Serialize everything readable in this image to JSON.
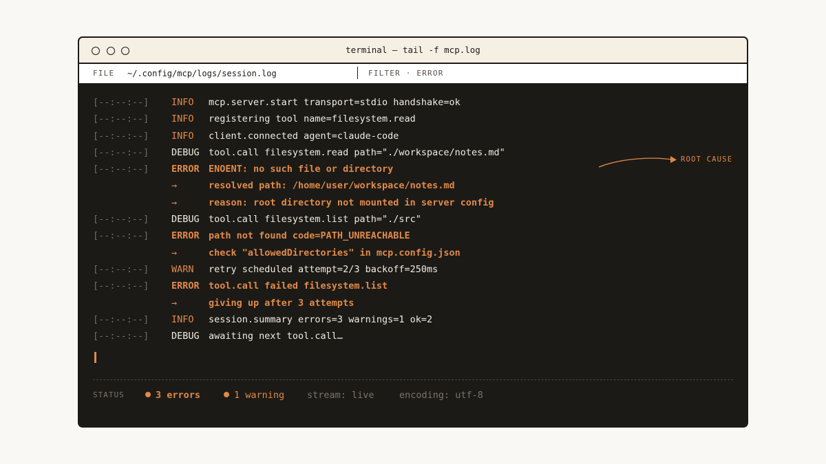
{
  "window": {
    "title": "terminal — tail -f mcp.log",
    "dots": [
      "window-close",
      "window-minimize",
      "window-maximize"
    ]
  },
  "pathbar": {
    "file_label": "FILE",
    "file_path": "~/.config/mcp/logs/session.log",
    "filter_label": "FILTER · ERROR"
  },
  "log": {
    "lines": [
      {
        "ts": "[--:--:--]",
        "level": "INFO",
        "msg": "mcp.server.start transport=stdio handshake=ok"
      },
      {
        "ts": "[--:--:--]",
        "level": "INFO",
        "msg": "registering tool name=filesystem.read"
      },
      {
        "ts": "[--:--:--]",
        "level": "INFO",
        "msg": "client.connected agent=claude-code"
      },
      {
        "ts": "[--:--:--]",
        "level": "DEBUG",
        "msg": "tool.call filesystem.read path=\"./workspace/notes.md\""
      },
      {
        "ts": "[--:--:--]",
        "level": "ERROR",
        "msg": "ENOENT: no such file or directory"
      },
      {
        "ts": "",
        "level": "→",
        "msg": "resolved path: /home/user/workspace/notes.md"
      },
      {
        "ts": "",
        "level": "→",
        "msg": "reason: root directory not mounted in server config"
      },
      {
        "ts": "[--:--:--]",
        "level": "DEBUG",
        "msg": "tool.call filesystem.list path=\"./src\""
      },
      {
        "ts": "[--:--:--]",
        "level": "ERROR",
        "msg": "path not found code=PATH_UNREACHABLE"
      },
      {
        "ts": "",
        "level": "→",
        "msg": "check \"allowedDirectories\" in mcp.config.json"
      },
      {
        "ts": "[--:--:--]",
        "level": "WARN",
        "msg": "retry scheduled attempt=2/3 backoff=250ms"
      },
      {
        "ts": "[--:--:--]",
        "level": "ERROR",
        "msg": "tool.call failed filesystem.list"
      },
      {
        "ts": "",
        "level": "→",
        "msg": "giving up after 3 attempts"
      },
      {
        "ts": "[--:--:--]",
        "level": "INFO",
        "msg": "session.summary errors=3 warnings=1 ok=2"
      },
      {
        "ts": "[--:--:--]",
        "level": "DEBUG",
        "msg": "awaiting next tool.call…"
      }
    ]
  },
  "annotation": {
    "text": "ROOT CAUSE"
  },
  "status": {
    "label": "STATUS",
    "errors": "3 errors",
    "warnings": "1 warning",
    "stream": "stream: live",
    "encoding": "encoding: utf-8"
  },
  "colors": {
    "accent": "#e08a4a",
    "terminal_bg": "#1c1a16",
    "titlebar_bg": "#f6efe4",
    "page_bg": "#faf8f4"
  }
}
